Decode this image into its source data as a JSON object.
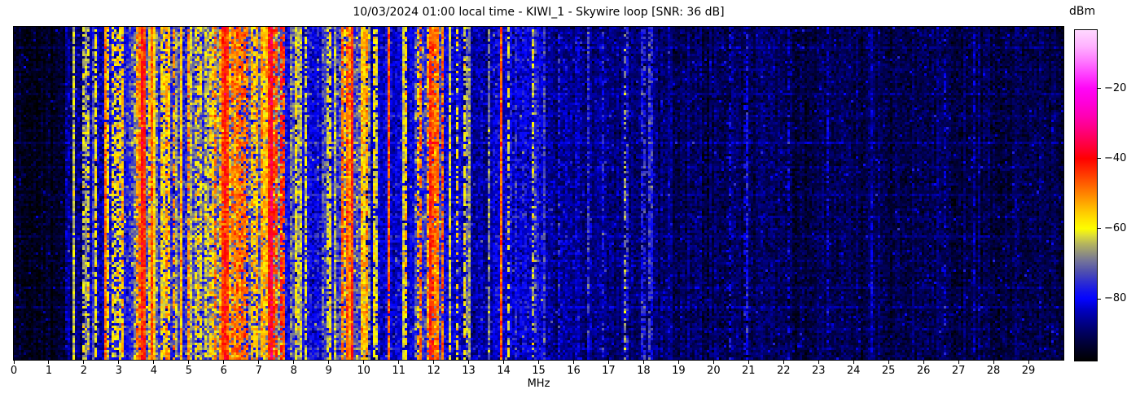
{
  "figure": {
    "title": "10/03/2024 01:00 local time - KIWI_1 - Skywire loop [SNR: 36 dB]",
    "background_color": "#ffffff",
    "axis_color": "#000000"
  },
  "chart_data": {
    "type": "heatmap",
    "subtype": "rf-spectrogram-waterfall",
    "title": "10/03/2024 01:00 local time - KIWI_1 - Skywire loop [SNR: 36 dB]",
    "timestamp_label": "10/03/2024 01:00 local time",
    "station_label": "KIWI_1",
    "antenna_label": "Skywire loop",
    "snr_label": "SNR: 36 dB",
    "xlabel": "MHz",
    "x_range_mhz": [
      0,
      30
    ],
    "x_ticks": [
      0,
      1,
      2,
      3,
      4,
      5,
      6,
      7,
      8,
      9,
      10,
      11,
      12,
      13,
      14,
      15,
      16,
      17,
      18,
      19,
      20,
      21,
      22,
      23,
      24,
      25,
      26,
      27,
      28,
      29
    ],
    "y_ticks": [],
    "colorbar": {
      "label": "dBm",
      "vmin": -97.6,
      "vmax": -3.4,
      "ticks": [
        -20,
        -40,
        -60,
        -80
      ]
    },
    "colormap_stops": [
      [
        -97.6,
        "#000000"
      ],
      [
        -95,
        "#00001c"
      ],
      [
        -92,
        "#000040"
      ],
      [
        -89,
        "#000068"
      ],
      [
        -86,
        "#000094"
      ],
      [
        -83,
        "#0000c4"
      ],
      [
        -80,
        "#0404ff"
      ],
      [
        -78,
        "#1212ee"
      ],
      [
        -75,
        "#3030ce"
      ],
      [
        -72,
        "#5252ac"
      ],
      [
        -69.5,
        "#70709c"
      ],
      [
        -67,
        "#90907e"
      ],
      [
        -64.5,
        "#b2b260"
      ],
      [
        -62,
        "#dcdc38"
      ],
      [
        -60,
        "#fdfd00"
      ],
      [
        -57.5,
        "#ffe400"
      ],
      [
        -55,
        "#ffc600"
      ],
      [
        -52,
        "#ff9e00"
      ],
      [
        -49,
        "#ff7600"
      ],
      [
        -46,
        "#ff4e00"
      ],
      [
        -43,
        "#ff2600"
      ],
      [
        -40,
        "#ff0000"
      ],
      [
        -37,
        "#ff0032"
      ],
      [
        -34,
        "#ff005e"
      ],
      [
        -31,
        "#ff008a"
      ],
      [
        -28,
        "#ff00b2"
      ],
      [
        -24,
        "#ff00da"
      ],
      [
        -20,
        "#ff06f6"
      ],
      [
        -16,
        "#ff40ff"
      ],
      [
        -12,
        "#ff7cff"
      ],
      [
        -8,
        "#ffb2ff"
      ],
      [
        -3.4,
        "#ffd8ff"
      ]
    ],
    "noise_floor_bands": [
      {
        "mhz": [
          0,
          1.45
        ],
        "base_dbm": -94.5,
        "noise_sigma": 2.0,
        "stations_per_mhz": 0,
        "station_dbm": [
          -90,
          -85
        ]
      },
      {
        "mhz": [
          1.45,
          2.05
        ],
        "base_dbm": -88,
        "noise_sigma": 3.0,
        "stations_per_mhz": 4,
        "station_dbm": [
          -80,
          -62
        ]
      },
      {
        "mhz": [
          2.05,
          2.55
        ],
        "base_dbm": -84,
        "noise_sigma": 3.5,
        "stations_per_mhz": 6,
        "station_dbm": [
          -76,
          -58
        ]
      },
      {
        "mhz": [
          2.55,
          3.35
        ],
        "base_dbm": -78,
        "noise_sigma": 4.0,
        "stations_per_mhz": 11,
        "station_dbm": [
          -68,
          -48
        ]
      },
      {
        "mhz": [
          3.35,
          4.15
        ],
        "base_dbm": -71,
        "noise_sigma": 5.0,
        "stations_per_mhz": 13,
        "station_dbm": [
          -60,
          -40
        ]
      },
      {
        "mhz": [
          4.15,
          5.15
        ],
        "base_dbm": -76,
        "noise_sigma": 4.5,
        "stations_per_mhz": 10,
        "station_dbm": [
          -68,
          -50
        ]
      },
      {
        "mhz": [
          5.15,
          5.65
        ],
        "base_dbm": -75,
        "noise_sigma": 4.5,
        "stations_per_mhz": 9,
        "station_dbm": [
          -66,
          -50
        ]
      },
      {
        "mhz": [
          5.65,
          6.45
        ],
        "base_dbm": -70,
        "noise_sigma": 5.0,
        "stations_per_mhz": 13,
        "station_dbm": [
          -58,
          -40
        ]
      },
      {
        "mhz": [
          6.45,
          7.05
        ],
        "base_dbm": -74,
        "noise_sigma": 4.5,
        "stations_per_mhz": 10,
        "station_dbm": [
          -62,
          -46
        ]
      },
      {
        "mhz": [
          7.05,
          7.65
        ],
        "base_dbm": -68,
        "noise_sigma": 5.0,
        "stations_per_mhz": 12,
        "station_dbm": [
          -56,
          -39
        ]
      },
      {
        "mhz": [
          7.65,
          8.45
        ],
        "base_dbm": -80,
        "noise_sigma": 3.5,
        "stations_per_mhz": 6,
        "station_dbm": [
          -72,
          -56
        ]
      },
      {
        "mhz": [
          8.45,
          9.35
        ],
        "base_dbm": -81,
        "noise_sigma": 3.5,
        "stations_per_mhz": 7,
        "station_dbm": [
          -74,
          -58
        ]
      },
      {
        "mhz": [
          9.35,
          10.05
        ],
        "base_dbm": -73,
        "noise_sigma": 4.5,
        "stations_per_mhz": 11,
        "station_dbm": [
          -60,
          -46
        ]
      },
      {
        "mhz": [
          10.05,
          11.45
        ],
        "base_dbm": -83,
        "noise_sigma": 3.0,
        "stations_per_mhz": 4,
        "station_dbm": [
          -72,
          -56
        ]
      },
      {
        "mhz": [
          11.45,
          12.3
        ],
        "base_dbm": -74,
        "noise_sigma": 4.5,
        "stations_per_mhz": 11,
        "station_dbm": [
          -60,
          -46
        ]
      },
      {
        "mhz": [
          12.3,
          13.05
        ],
        "base_dbm": -82,
        "noise_sigma": 3.5,
        "stations_per_mhz": 5,
        "station_dbm": [
          -72,
          -60
        ]
      },
      {
        "mhz": [
          13.05,
          13.75
        ],
        "base_dbm": -85,
        "noise_sigma": 3.0,
        "stations_per_mhz": 2,
        "station_dbm": [
          -78,
          -68
        ]
      },
      {
        "mhz": [
          13.75,
          14.05
        ],
        "base_dbm": -83,
        "noise_sigma": 3.0,
        "stations_per_mhz": 1,
        "station_dbm": [
          -70,
          -64
        ]
      },
      {
        "mhz": [
          14.05,
          15.15
        ],
        "base_dbm": -82,
        "noise_sigma": 3.5,
        "stations_per_mhz": 4,
        "station_dbm": [
          -74,
          -62
        ]
      },
      {
        "mhz": [
          15.15,
          16.55
        ],
        "base_dbm": -86.5,
        "noise_sigma": 2.8,
        "stations_per_mhz": 2,
        "station_dbm": [
          -80,
          -72
        ]
      },
      {
        "mhz": [
          16.55,
          18.25
        ],
        "base_dbm": -88,
        "noise_sigma": 2.5,
        "stations_per_mhz": 1.5,
        "station_dbm": [
          -80,
          -74
        ]
      },
      {
        "mhz": [
          18.25,
          22
        ],
        "base_dbm": -90,
        "noise_sigma": 2.5,
        "stations_per_mhz": 0.8,
        "station_dbm": [
          -84,
          -78
        ]
      },
      {
        "mhz": [
          22,
          27
        ],
        "base_dbm": -91,
        "noise_sigma": 2.3,
        "stations_per_mhz": 0.5,
        "station_dbm": [
          -85,
          -80
        ]
      },
      {
        "mhz": [
          27,
          30
        ],
        "base_dbm": -91.5,
        "noise_sigma": 2.3,
        "stations_per_mhz": 0.4,
        "station_dbm": [
          -86,
          -80
        ]
      }
    ],
    "signal_lines": [
      {
        "mhz": 1.93,
        "dbm": -63,
        "duty": 0.6,
        "width": 1
      },
      {
        "mhz": 2.31,
        "dbm": -60,
        "duty": 0.8,
        "width": 1
      },
      {
        "mhz": 3.6,
        "dbm": -41,
        "duty": 1.0,
        "width": 2
      },
      {
        "mhz": 5.99,
        "dbm": -42,
        "duty": 1.0,
        "width": 2
      },
      {
        "mhz": 7.25,
        "dbm": -42,
        "duty": 1.0,
        "width": 2
      },
      {
        "mhz": 7.35,
        "dbm": -37,
        "duty": 1.0,
        "width": 1
      },
      {
        "mhz": 9.62,
        "dbm": -43,
        "duty": 1.0,
        "width": 1
      },
      {
        "mhz": 10.02,
        "dbm": -52,
        "duty": 0.9,
        "width": 1
      },
      {
        "mhz": 10.65,
        "dbm": -47,
        "duty": 0.9,
        "width": 1
      },
      {
        "mhz": 11.87,
        "dbm": -43,
        "duty": 1.0,
        "width": 1
      },
      {
        "mhz": 12.62,
        "dbm": -58,
        "duty": 0.45,
        "width": 1
      },
      {
        "mhz": 13.85,
        "dbm": -47,
        "duty": 1.0,
        "width": 1
      },
      {
        "mhz": 14.12,
        "dbm": -62,
        "duty": 0.5,
        "width": 1
      },
      {
        "mhz": 16.8,
        "dbm": -78,
        "duty": 0.5,
        "width": 1
      },
      {
        "mhz": 17.45,
        "dbm": -68,
        "duty": 0.55,
        "width": 1
      },
      {
        "mhz": 18.0,
        "dbm": -76,
        "duty": 0.5,
        "width": 1
      },
      {
        "mhz": 26.6,
        "dbm": -83,
        "duty": 0.5,
        "width": 1
      }
    ],
    "time_streaks": [
      {
        "t": 0.06,
        "db": 3
      },
      {
        "t": 0.13,
        "db": 2
      },
      {
        "t": 0.2,
        "db": 2.5
      },
      {
        "t": 0.27,
        "db": 2
      },
      {
        "t": 0.35,
        "db": 4.5
      },
      {
        "t": 0.42,
        "db": 2
      },
      {
        "t": 0.5,
        "db": 2.5
      },
      {
        "t": 0.57,
        "db": 2
      },
      {
        "t": 0.63,
        "db": 3
      },
      {
        "t": 0.7,
        "db": 2
      },
      {
        "t": 0.78,
        "db": 2.5
      },
      {
        "t": 0.845,
        "db": 4
      },
      {
        "t": 0.91,
        "db": 2.5
      },
      {
        "t": 0.97,
        "db": 2
      }
    ],
    "render": {
      "cols": 430,
      "rows": 136,
      "seed": 42
    }
  }
}
